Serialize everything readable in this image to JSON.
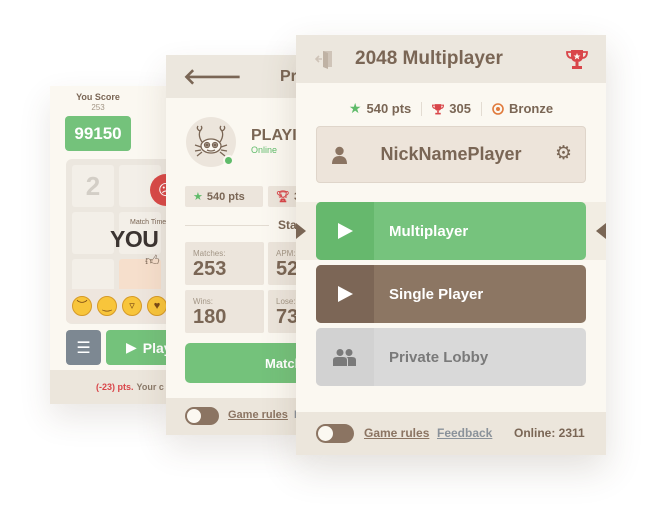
{
  "game_panel": {
    "score_label": "You Score",
    "score_sub": "253",
    "score_value": "99150",
    "tile_value": "2",
    "match_time_label": "Match Time",
    "result_text": "YOU",
    "emojis": [
      "sad",
      "smile",
      "grin",
      "kiss"
    ],
    "play_label": "Play",
    "footer_penalty": "(-23) pts.",
    "footer_text": "Your c"
  },
  "profile_panel": {
    "title": "Pr",
    "player_name": "PLAYI",
    "status": "Online",
    "points": "540 pts",
    "trophies": "3",
    "stats_title": "Sta",
    "stats": [
      {
        "label": "Matches:",
        "value": "253"
      },
      {
        "label": "APM:",
        "value": "52"
      },
      {
        "label": "Wins:",
        "value": "180"
      },
      {
        "label": "Lose:",
        "value": "73"
      }
    ],
    "match_button": "Match",
    "game_rules": "Game rules",
    "feedback": "F"
  },
  "menu_panel": {
    "title": "2048 Multiplayer",
    "points": "540 pts",
    "trophies": "305",
    "rank": "Bronze",
    "nickname": "NickNamePlayer",
    "buttons": [
      {
        "label": "Multiplayer",
        "icon": "play-icon"
      },
      {
        "label": "Single Player",
        "icon": "play-icon"
      },
      {
        "label": "Private Lobby",
        "icon": "users-icon"
      }
    ],
    "game_rules": "Game rules",
    "feedback": "Feedback",
    "online": "Online: 2311"
  },
  "colors": {
    "green": "#76c37d",
    "brown": "#8c7663",
    "gray": "#d9d9d9",
    "red": "#d94a48",
    "text_brown": "#7a6655",
    "background": "#fbf8f1"
  }
}
